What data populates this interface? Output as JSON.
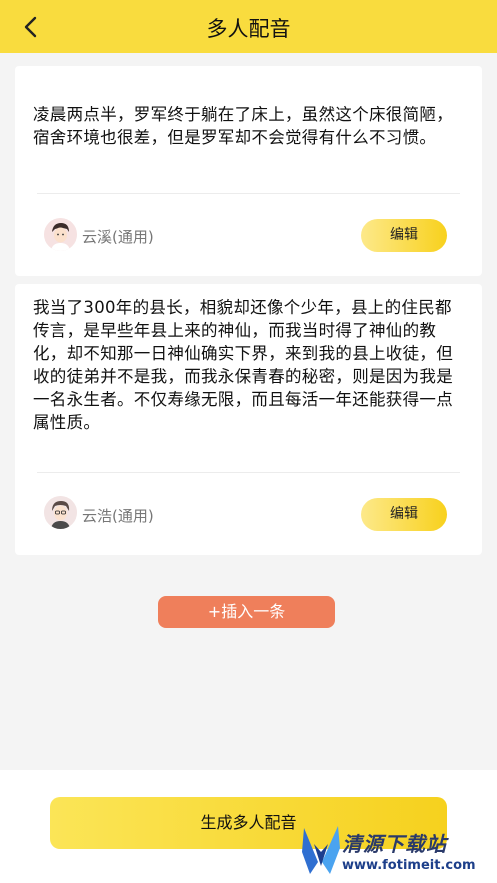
{
  "header": {
    "title": "多人配音",
    "back_icon": "chevron-left-icon"
  },
  "cards": [
    {
      "text": "凌晨两点半，罗军终于躺在了床上，虽然这个床很简陋，宿舍环境也很差，但是罗军却不会觉得有什么不习惯。",
      "voice": "云溪(通用)",
      "edit_label": "编辑"
    },
    {
      "text": "我当了300年的县长，相貌却还像个少年，县上的住民都传言，是早些年县上来的神仙，而我当时得了神仙的教化，却不知那一日神仙确实下界，来到我的县上收徒，但收的徒弟并不是我，而我永保青春的秘密，则是因为我是一名永生者。不仅寿缘无限，而且每活一年还能获得一点属性质。",
      "voice": "云浩(通用)",
      "edit_label": "编辑"
    }
  ],
  "insert_label": "+插入一条",
  "generate_label": "生成多人配音",
  "watermark": {
    "name": "清源下载站",
    "url": "www.fotimeit.com"
  },
  "colors": {
    "accent": "#f9dc3e",
    "insert": "#ef7f5b",
    "background": "#f4f4f4"
  }
}
